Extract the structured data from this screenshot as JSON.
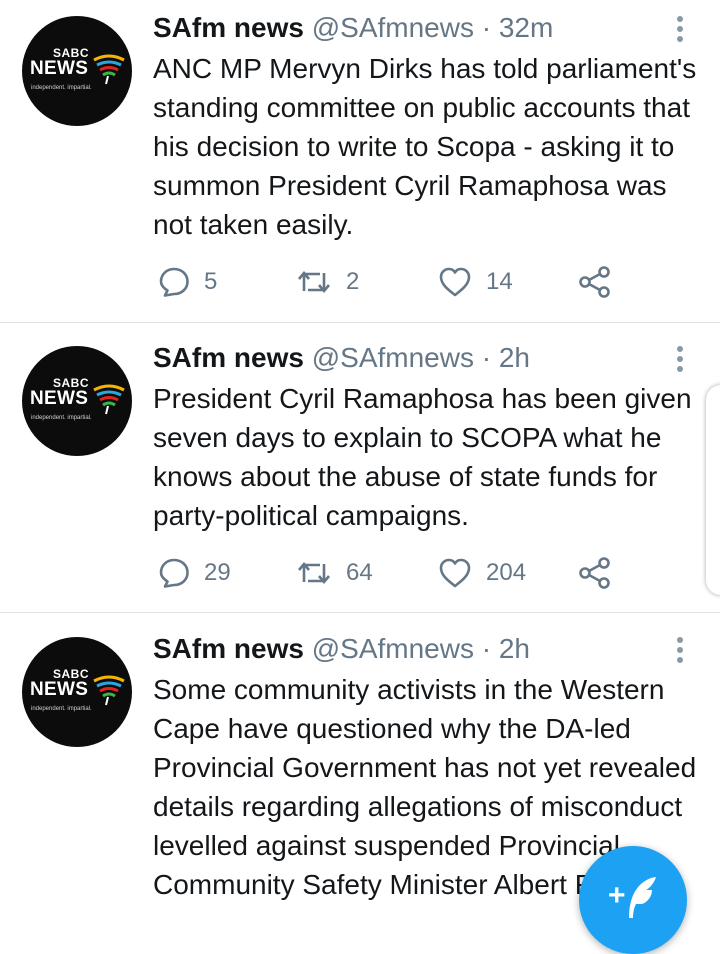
{
  "tweets": [
    {
      "avatar": {
        "line1": "SABC",
        "line2": "NEWS",
        "line3": "independent. impartial."
      },
      "name": "SAfm news",
      "handle": "@SAfmnews",
      "separator": "·",
      "time": "32m",
      "text": "ANC MP Mervyn Dirks has told parliament's standing committee on public accounts that his decision to write to Scopa - asking it to summon President Cyril Ramaphosa was not taken easily.",
      "replies": "5",
      "retweets": "2",
      "likes": "14"
    },
    {
      "avatar": {
        "line1": "SABC",
        "line2": "NEWS",
        "line3": "independent. impartial."
      },
      "name": "SAfm news",
      "handle": "@SAfmnews",
      "separator": "·",
      "time": "2h",
      "text": "President Cyril Ramaphosa has been given seven days to explain to SCOPA what he knows about the abuse of state funds for party-political campaigns.",
      "replies": "29",
      "retweets": "64",
      "likes": "204"
    },
    {
      "avatar": {
        "line1": "SABC",
        "line2": "NEWS",
        "line3": "independent. impartial."
      },
      "name": "SAfm news",
      "handle": "@SAfmnews",
      "separator": "·",
      "time": "2h",
      "text": "Some community activists in the Western Cape have questioned why the DA-led Provincial Government has not yet revealed details regarding allegations of misconduct levelled against suspended Provincial Community Safety Minister Albert Fritz"
    }
  ],
  "fab": {
    "plus": "+"
  },
  "icons": {
    "reply": "reply-icon",
    "retweet": "retweet-icon",
    "like": "heart-icon",
    "share": "share-icon",
    "more": "more-vertical-icon",
    "compose": "compose-feather-icon"
  },
  "colors": {
    "text": "#14171a",
    "secondary": "#657786",
    "accent": "#1da1f2",
    "divider": "#dfe3e6"
  }
}
